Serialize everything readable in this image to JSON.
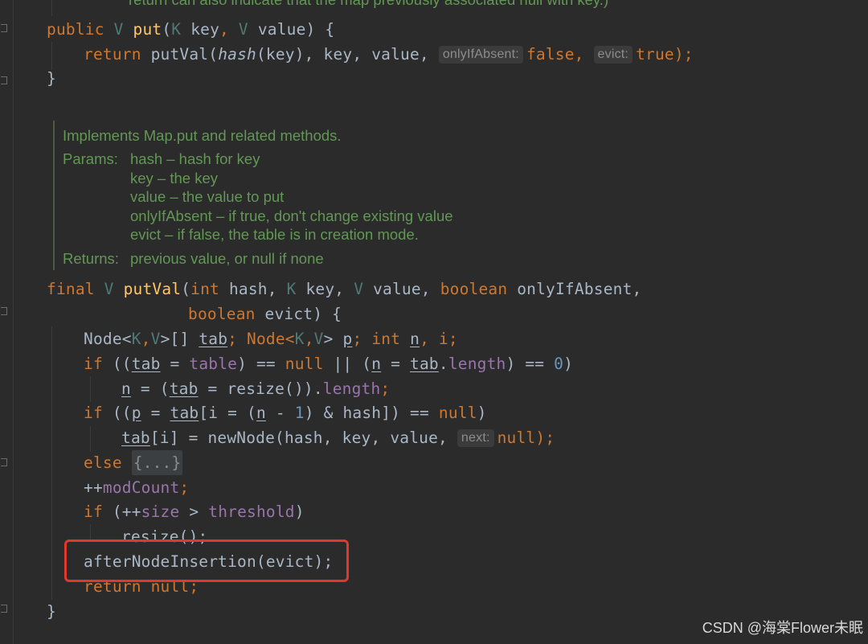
{
  "editor": {
    "top_fragment": "return can also indicate that the map previously associated null with key.)",
    "put": {
      "kw_public": "public",
      "type_v": "V",
      "name": "put",
      "open": "(",
      "type_k": "K",
      "p_key": "key",
      "comma": ",",
      "type_v2": "V",
      "p_value": "value",
      "close": ") {",
      "ret": "return",
      "call": "putVal(",
      "hash_fn": "hash",
      "hash_args": "(key), key, value, ",
      "hint_only": "onlyIfAbsent:",
      "v_false": "false",
      "comma2": ", ",
      "hint_evict": "evict:",
      "v_true": "true",
      "end": ");",
      "brace": "}"
    },
    "doc": {
      "summary": "Implements Map.put and related methods.",
      "params_label": "Params:",
      "params": [
        "hash – hash for key",
        "key – the key",
        "value – the value to put",
        "onlyIfAbsent – if true, don't change existing value",
        "evict – if false, the table is in creation mode."
      ],
      "returns_label": "Returns:",
      "returns": "previous value, or null if none"
    },
    "putval": {
      "kw_final": "final",
      "type_v": "V",
      "name": "putVal",
      "open": "(",
      "kw_int": "int",
      "p_hash": "hash, ",
      "type_k": "K",
      "p_key": "key, ",
      "type_v2": "V",
      "p_value": "value, ",
      "kw_boolean": "boolean",
      "p_only": "onlyIfAbsent,",
      "kw_boolean2": "boolean",
      "p_evict": "evict) {"
    },
    "body": {
      "l1_a": "Node<",
      "l1_k": "K",
      "l1_b": ",",
      "l1_v": "V",
      "l1_c": ">[] ",
      "l1_tab": "tab",
      "l1_d": "; Node<",
      "l1_k2": "K",
      "l1_e": ",",
      "l1_v2": "V",
      "l1_f": "> ",
      "l1_p": "p",
      "l1_g": "; ",
      "l1_int": "int",
      "l1_n": "n",
      "l1_h": ", i;",
      "l2_if": "if",
      "l2_a": " ((",
      "l2_tab": "tab",
      "l2_b": " = ",
      "l2_table": "table",
      "l2_c": ") == ",
      "l2_null": "null",
      "l2_d": " || (",
      "l2_n": "n",
      "l2_e": " = ",
      "l2_tab2": "tab",
      "l2_f": ".",
      "l2_len": "length",
      "l2_g": ") == ",
      "l2_zero": "0",
      "l2_h": ")",
      "l3_n": "n",
      "l3_a": " = (",
      "l3_tab": "tab",
      "l3_b": " = resize()).",
      "l3_len": "length",
      "l3_c": ";",
      "l4_if": "if",
      "l4_a": " ((",
      "l4_p": "p",
      "l4_b": " = ",
      "l4_tab": "tab",
      "l4_c": "[i = (",
      "l4_n": "n",
      "l4_d": " - ",
      "l4_one": "1",
      "l4_e": ") & hash]) == ",
      "l4_null": "null",
      "l4_f": ")",
      "l5_tab": "tab",
      "l5_a": "[i] = newNode(hash, key, value, ",
      "l5_hint": "next:",
      "l5_null": "null",
      "l5_b": ");",
      "l6_else": "else",
      "l6_fold": "{...}",
      "l7_a": "++",
      "l7_mod": "modCount",
      "l7_b": ";",
      "l8_if": "if",
      "l8_a": " (++",
      "l8_size": "size",
      "l8_b": " > ",
      "l8_thr": "threshold",
      "l8_c": ")",
      "l9": "resize();",
      "l10": "afterNodeInsertion(evict);",
      "l11_ret": "return",
      "l11_null": "null",
      "l11_end": ";",
      "close": "}"
    }
  },
  "watermark": "CSDN @海棠Flower未眠",
  "colors": {
    "background": "#2b2b2b",
    "keyword": "#cc7832",
    "function": "#ffc66d",
    "field": "#9876aa",
    "number": "#6897bb",
    "doc": "#629755",
    "highlight": "#e0392b"
  }
}
